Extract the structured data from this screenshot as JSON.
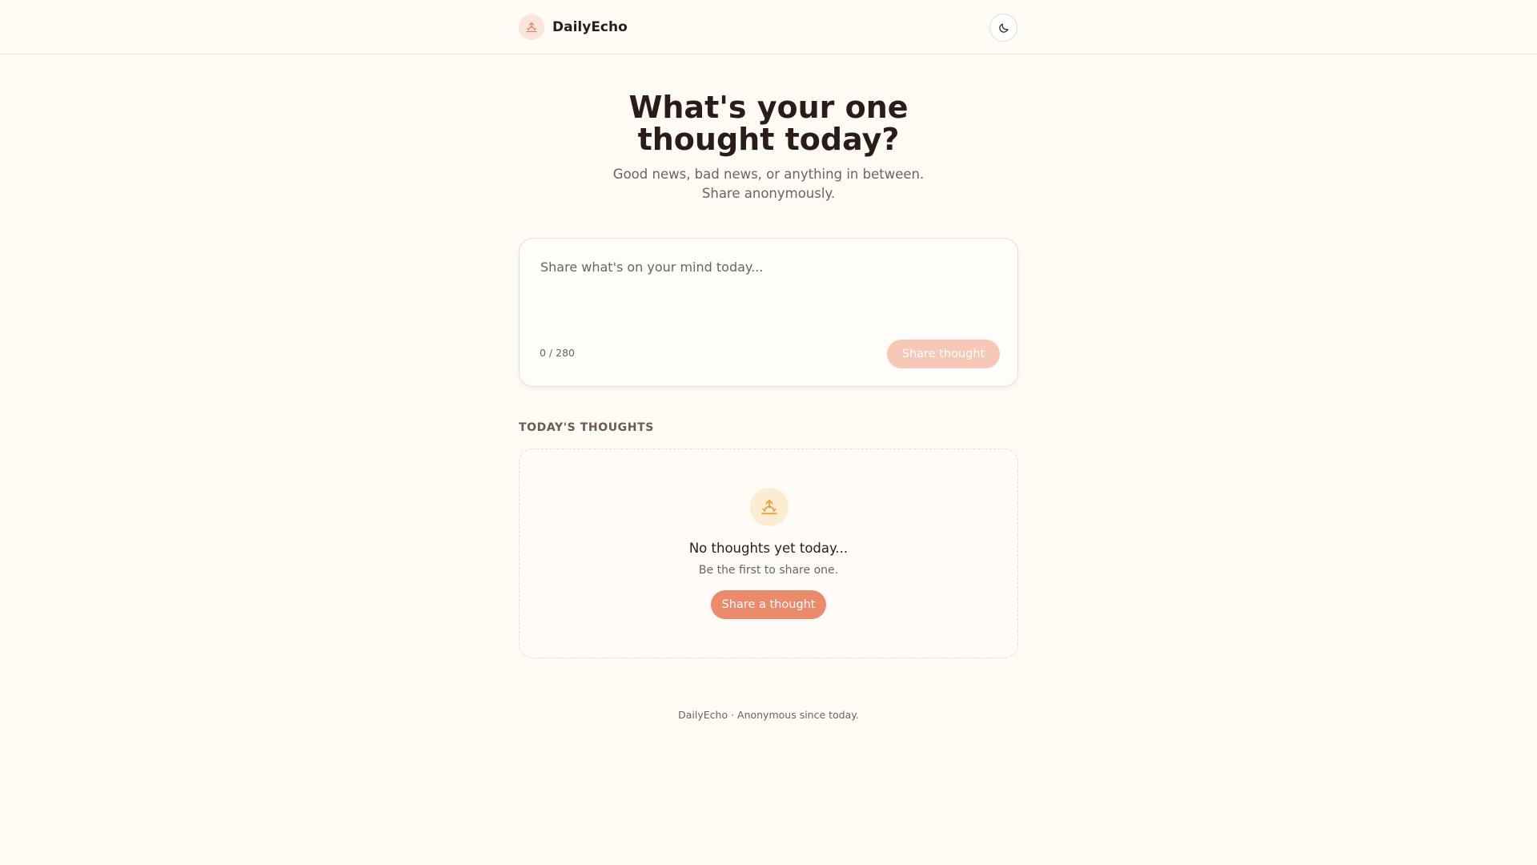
{
  "header": {
    "brand_name": "DailyEcho",
    "logo_icon": "sunrise-icon",
    "theme_toggle_icon": "moon-icon"
  },
  "hero": {
    "title": "What's your one thought today?",
    "subtitle": "Good news, bad news, or anything in between. Share anonymously."
  },
  "composer": {
    "placeholder": "Share what's on your mind today...",
    "value": "",
    "char_count": "0 / 280",
    "submit_label": "Share thought",
    "submit_enabled": false
  },
  "feed": {
    "section_title": "TODAY'S THOUGHTS",
    "empty_icon": "sunrise-icon",
    "empty_title": "No thoughts yet today...",
    "empty_subtitle": "Be the first to share one.",
    "cta_label": "Share a thought"
  },
  "footer": {
    "text": "DailyEcho · Anonymous since today."
  },
  "colors": {
    "background": "#fefaf4",
    "accent": "#ec8b6c",
    "accent_disabled": "#f7c8b7",
    "text_primary": "#2a1d17",
    "text_secondary": "#6b6460"
  }
}
